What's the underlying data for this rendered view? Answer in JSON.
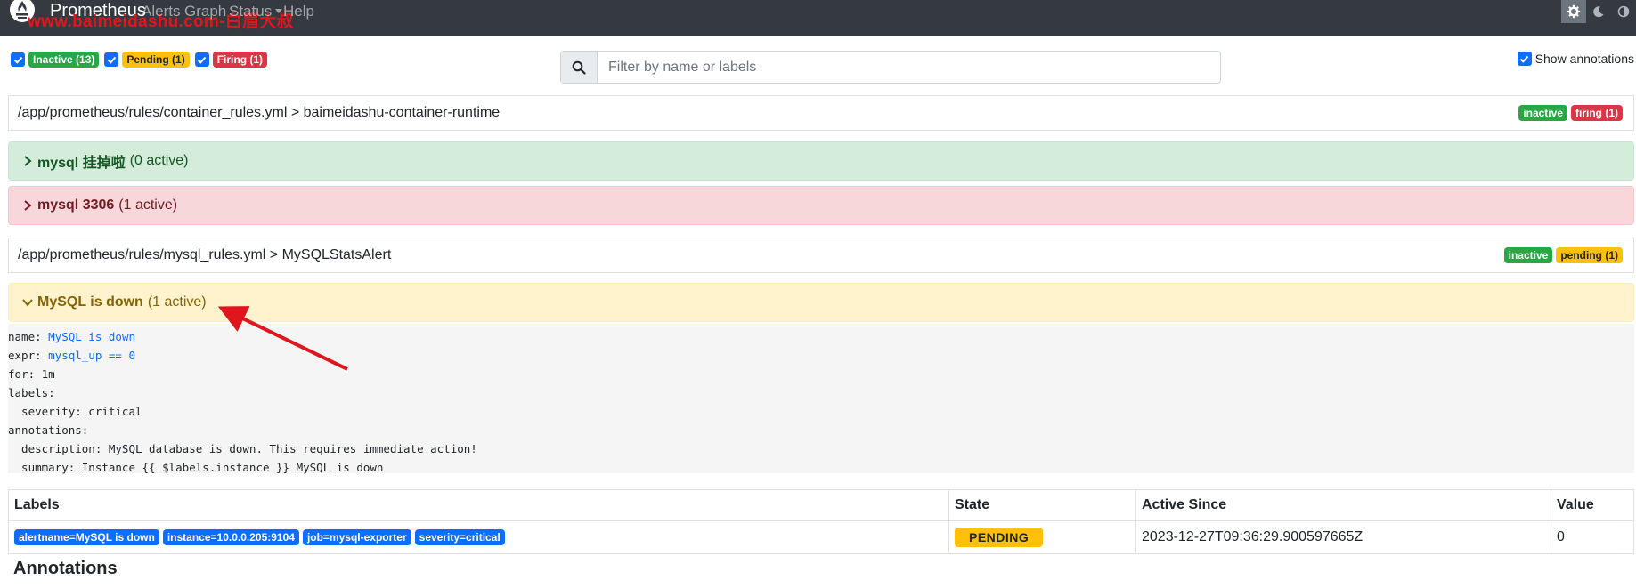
{
  "navbar": {
    "brand": "Prometheus",
    "watermark": "www.baimeidashu.com-白眉大叔",
    "links": [
      "Alerts",
      "Graph",
      "Status",
      "Help"
    ]
  },
  "filters": {
    "inactive": "Inactive (13)",
    "pending": "Pending (1)",
    "firing": "Firing (1)"
  },
  "search": {
    "placeholder": "Filter by name or labels"
  },
  "show_annotations": "Show annotations",
  "groups": [
    {
      "path": "/app/prometheus/rules/container_rules.yml > baimeidashu-container-runtime",
      "badges": [
        "inactive",
        "firing (1)"
      ],
      "alerts": [
        {
          "name": "mysql 挂掉啦",
          "count": "(0 active)"
        },
        {
          "name": "mysql 3306",
          "count": "(1 active)"
        }
      ]
    },
    {
      "path": "/app/prometheus/rules/mysql_rules.yml > MySQLStatsAlert",
      "badges": [
        "inactive",
        "pending (1)"
      ],
      "alerts": [
        {
          "name": "MySQL is down",
          "count": "(1 active)"
        }
      ]
    }
  ],
  "rule_definition": {
    "name_key": "name: ",
    "name_val": "MySQL is down",
    "expr_key": "expr: ",
    "expr_val": "mysql_up == 0",
    "for": "for: 1m",
    "labels": "labels:",
    "severity": "  severity: critical",
    "annotations": "annotations:",
    "description": "  description: MySQL database is down. This requires immediate action!",
    "summary": "  summary: Instance {{ $labels.instance }} MySQL is down"
  },
  "table": {
    "headers": [
      "Labels",
      "State",
      "Active Since",
      "Value"
    ],
    "row": {
      "labels": [
        "alertname=MySQL is down",
        "instance=10.0.0.205:9104",
        "job=mysql-exporter",
        "severity=critical"
      ],
      "state": "PENDING",
      "active_since": "2023-12-27T09:36:29.900597665Z",
      "value": "0"
    }
  },
  "annotations_heading": "Annotations",
  "colors": {
    "navbar": "#343a40",
    "success": "#28a745",
    "warning": "#ffc107",
    "danger": "#dc3545",
    "primary": "#0d6efd",
    "arrow": "#e0161e"
  }
}
